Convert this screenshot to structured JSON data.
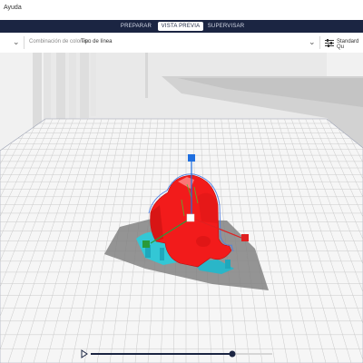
{
  "menu": {
    "help_label": "Ayuda"
  },
  "tabs": [
    {
      "label": "PREPARAR",
      "active": false
    },
    {
      "label": "VISTA PREVIA",
      "active": true
    },
    {
      "label": "SUPERVISAR",
      "active": false
    }
  ],
  "toolbar": {
    "color_scheme_label": "Combinación de colores:",
    "color_scheme_value": "Tipo de línea",
    "profile_label": "Standard Qu"
  },
  "colors": {
    "header_bg": "#1b2542",
    "model": "#f21b1b",
    "support": "#2fc0d0",
    "axis_x": "#e02020",
    "axis_y": "#2a9a3a",
    "axis_z": "#1f6fe0",
    "build_plate": "#f4f4f4",
    "grid": "#c9c9c9",
    "slider": "#1b2542"
  },
  "icons": [
    "chevron-down-icon",
    "settings-sliders-icon",
    "play-icon"
  ],
  "layer_slider": {
    "progress": 0.78
  }
}
